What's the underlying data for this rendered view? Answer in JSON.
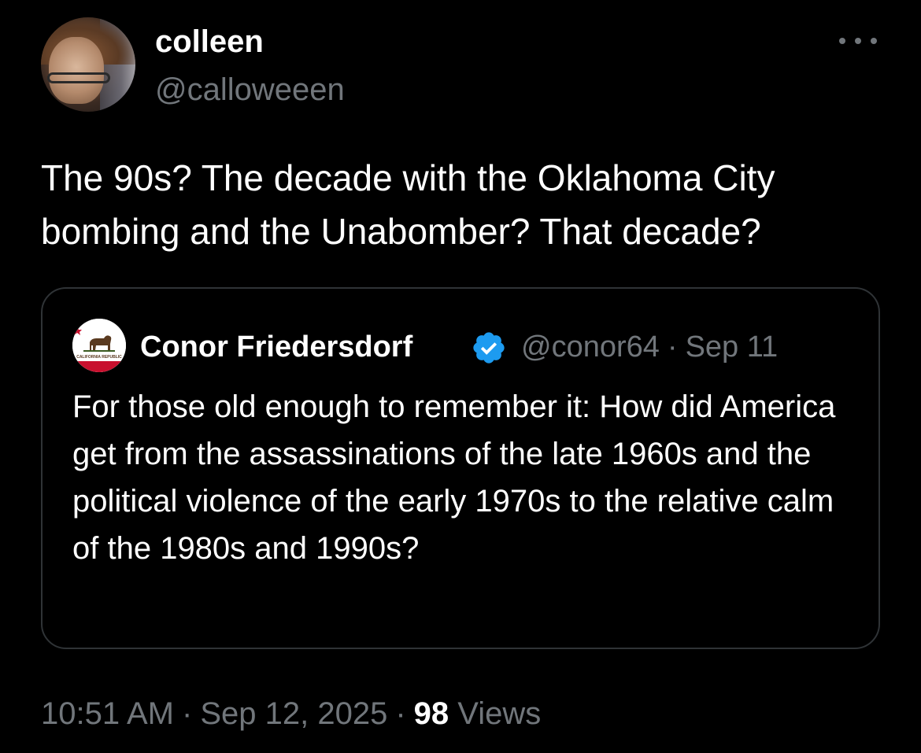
{
  "author": {
    "display_name": "colleen",
    "handle": "@calloweeen"
  },
  "more_icon": "more-horizontal-icon",
  "tweet": {
    "text": "The 90s? The decade with the Oklahoma City bombing and the Unabomber? That decade?"
  },
  "quoted_tweet": {
    "avatar_icon": "california-bear-flag-icon",
    "avatar_text": "CALIFORNIA REPUBLIC",
    "display_name": "Conor Friedersdorf",
    "verified_icon": "verified-badge-icon",
    "handle": "@conor64",
    "separator": "·",
    "date": "Sep 11",
    "text": "For those old enough to remember it: How did America get from the assassinations of the late 1960s and the political violence of the early 1970s to the relative calm of the 1980s and 1990s?"
  },
  "meta": {
    "time": "10:51 AM",
    "separator": "·",
    "date": "Sep 12, 2025",
    "views_count": "98",
    "views_label": "Views"
  },
  "colors": {
    "background": "#000000",
    "primary_text": "#ffffff",
    "secondary_text": "#71767b",
    "border": "#2f3336",
    "verified_blue": "#1d9bf0"
  }
}
